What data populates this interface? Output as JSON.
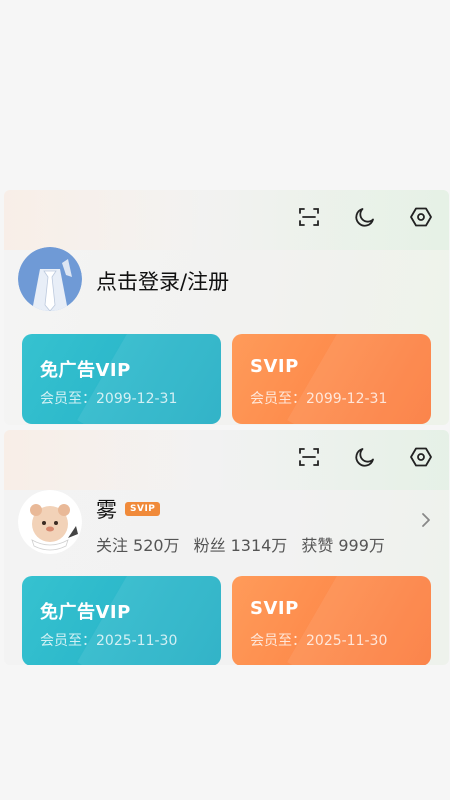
{
  "panel_logged_out": {
    "login_text": "点击登录/注册",
    "toolbar": [
      "scan-icon",
      "moon-icon",
      "settings-icon"
    ],
    "cards": [
      {
        "title": "免广告VIP",
        "expire": "会员至：2099-12-31",
        "color": "#21adc4"
      },
      {
        "title": "SVIP",
        "expire": "会员至：2099-12-31",
        "color": "#fb7a3c"
      }
    ]
  },
  "panel_logged_in": {
    "username": "雾",
    "badge": "SVIP",
    "stats": [
      {
        "label": "关注",
        "value": "520万"
      },
      {
        "label": "粉丝",
        "value": "1314万"
      },
      {
        "label": "获赞",
        "value": "999万"
      }
    ],
    "toolbar": [
      "scan-icon",
      "moon-icon",
      "settings-icon"
    ],
    "cards": [
      {
        "title": "免广告VIP",
        "expire": "会员至：2025-11-30",
        "color": "#21adc4"
      },
      {
        "title": "SVIP",
        "expire": "会员至：2025-11-30",
        "color": "#fb7a3c"
      }
    ]
  }
}
